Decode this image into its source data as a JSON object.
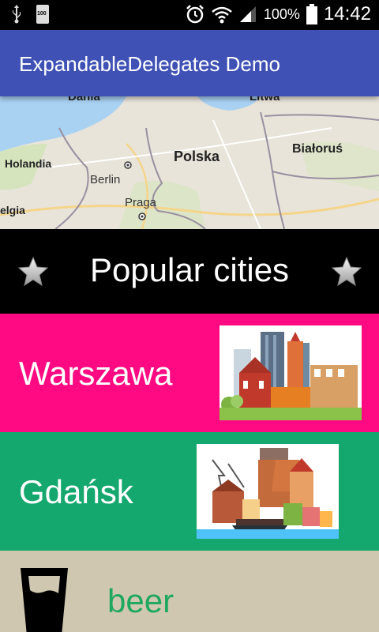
{
  "status_bar": {
    "battery_small_label": "100",
    "battery_percent": "100%",
    "time": "14:42",
    "icons": [
      "usb-icon",
      "battery-small-icon",
      "alarm-icon",
      "wifi-icon",
      "signal-icon",
      "battery-icon"
    ]
  },
  "app_bar": {
    "title": "ExpandableDelegates Demo"
  },
  "map": {
    "labels": {
      "dania": "Dania",
      "litwa": "Litwa",
      "polska": "Polska",
      "bialorus": "Białoruś",
      "holandia": "Holandia",
      "berlin": "Berlin",
      "praga": "Praga",
      "belgia": "elgia"
    }
  },
  "header": {
    "title": "Popular cities"
  },
  "cities": [
    {
      "name": "Warszawa",
      "color": "#ff0a82"
    },
    {
      "name": "Gdańsk",
      "color": "#14a86e"
    }
  ],
  "beer": {
    "label": "beer",
    "color": "#d0c7b1"
  }
}
